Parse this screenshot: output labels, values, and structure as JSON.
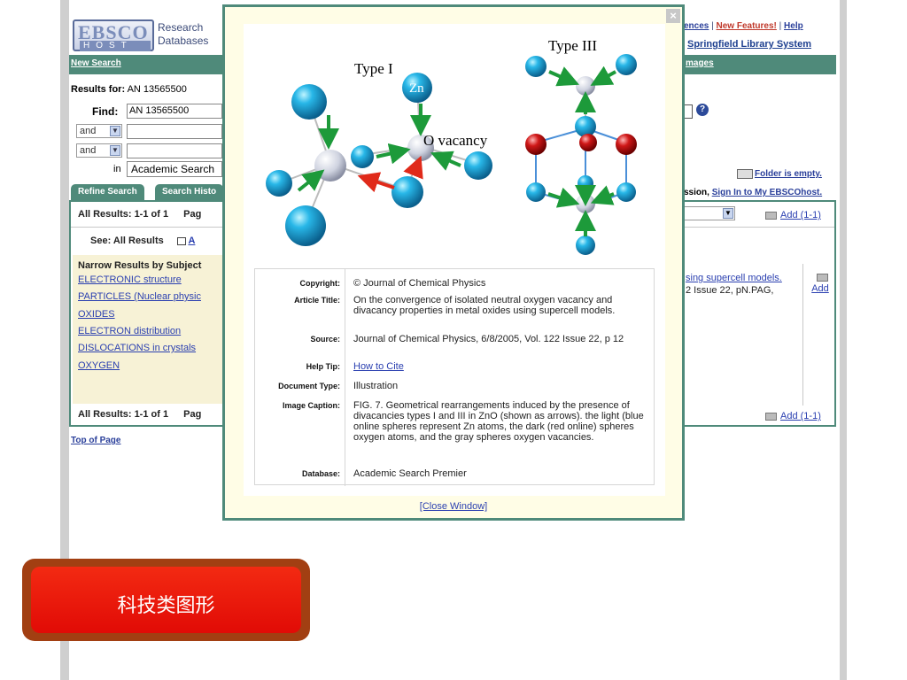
{
  "header": {
    "logo_top": "EBSCO",
    "logo_bottom": "HOST",
    "logo_sub_1": "Research",
    "logo_sub_2": "Databases",
    "links": [
      "ences",
      "New Features!",
      "Help"
    ],
    "library": "Springfield Library System"
  },
  "nav": {
    "new_search": "New Search",
    "images": "mages"
  },
  "search": {
    "results_for_label": "Results for:",
    "results_for_value": "AN 13565500",
    "find_label": "Find:",
    "find_value": "AN 13565500",
    "bool_1": "and",
    "bool_2": "and",
    "in_label": "in",
    "database": "Academic Search"
  },
  "right_panel": {
    "folder": "Folder is empty.",
    "session_prefix": "ssion,",
    "sign_in": "Sign In to My EBSCOhost."
  },
  "tabs": [
    "Refine Search",
    "Search Histo"
  ],
  "results": {
    "all_results_top": "All Results: 1-1 of 1",
    "page_top": "Pag",
    "see_all": "See: All Results",
    "narrow_title": "Narrow Results by Subject",
    "subjects": [
      "ELECTRONIC structure",
      "PARTICLES (Nuclear physic",
      "OXIDES",
      "ELECTRON distribution",
      "DISLOCATIONS in crystals",
      "OXYGEN"
    ],
    "all_results_bottom": "All Results: 1-1 of 1",
    "page_bottom": "Pag",
    "add_top": "Add (1-1)",
    "add_bottom": "Add (1-1)",
    "result_link": "sing supercell models.",
    "result_source": "2 Issue 22, pN.PAG,",
    "add_item": "Add",
    "see_all_a": "A"
  },
  "top_of_page": "Top of Page",
  "modal": {
    "figure_labels": {
      "type1": "Type I",
      "type3": "Type III",
      "zn": "Zn",
      "vacancy": "O vacancy"
    },
    "copyright_label": "Copyright:",
    "copyright": "© Journal of Chemical Physics",
    "title_label": "Article Title:",
    "title": "On the convergence of isolated neutral oxygen vacancy and divacancy properties in metal oxides using supercell models.",
    "source_label": "Source:",
    "source": "Journal of Chemical Physics, 6/8/2005, Vol. 122 Issue 22, p 12",
    "help_label": "Help Tip:",
    "help": "How to Cite",
    "doctype_label": "Document Type:",
    "doctype": "Illustration",
    "caption_label": "Image Caption:",
    "caption": "FIG. 7. Geometrical rearrangements induced by the presence of divacancies types I and III in ZnO (shown as arrows). the light (blue online spheres represent Zn atoms, the dark (red online) spheres oxygen atoms, and the gray spheres oxygen vacancies.",
    "database_label": "Database:",
    "database": "Academic Search Premier",
    "close_window": "[Close Window]"
  },
  "badge": {
    "text": "科技类图形"
  },
  "colors": {
    "accent": "#4f8a7a",
    "link": "#2a3fb0",
    "badge": "#e10b06"
  }
}
